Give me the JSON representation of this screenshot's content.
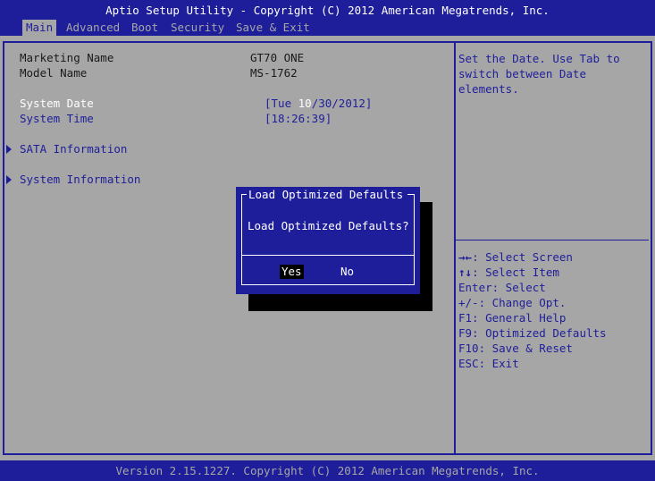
{
  "window": {
    "title": "Aptio Setup Utility - Copyright (C) 2012 American Megatrends, Inc.",
    "footer": "Version 2.15.1227. Copyright (C) 2012 American Megatrends, Inc."
  },
  "tabs": [
    {
      "label": "Main"
    },
    {
      "label": "Advanced"
    },
    {
      "label": "Boot"
    },
    {
      "label": "Security"
    },
    {
      "label": "Save & Exit"
    }
  ],
  "info": {
    "marketing_label": "Marketing Name",
    "marketing_value": "GT70 ONE",
    "model_label": "Model Name",
    "model_value": "MS-1762"
  },
  "system_date": {
    "label": "System Date",
    "prefix": "[Tue ",
    "highlight": "10",
    "suffix": "/30/2012]"
  },
  "system_time": {
    "label": "System Time",
    "value": "[18:26:39]"
  },
  "submenus": [
    {
      "label": "SATA Information"
    },
    {
      "label": "System Information"
    }
  ],
  "help": {
    "description": "Set the Date. Use Tab to switch between Date elements."
  },
  "keys": [
    {
      "glyph": "→←",
      "text": ": Select Screen"
    },
    {
      "glyph": "↑↓",
      "text": ": Select Item"
    },
    {
      "glyph": "",
      "text": "Enter: Select"
    },
    {
      "glyph": "",
      "text": "+/-: Change Opt."
    },
    {
      "glyph": "",
      "text": "F1: General Help"
    },
    {
      "glyph": "",
      "text": "F9: Optimized Defaults"
    },
    {
      "glyph": "",
      "text": "F10: Save & Reset"
    },
    {
      "glyph": "",
      "text": "ESC: Exit"
    }
  ],
  "dialog": {
    "title": "Load Optimized Defaults",
    "question": "Load Optimized Defaults?",
    "yes": "Yes",
    "no": "No"
  },
  "colors": {
    "background": "#a6a6a6",
    "accent": "#1e1e9a",
    "highlight_text": "#ffffff"
  }
}
